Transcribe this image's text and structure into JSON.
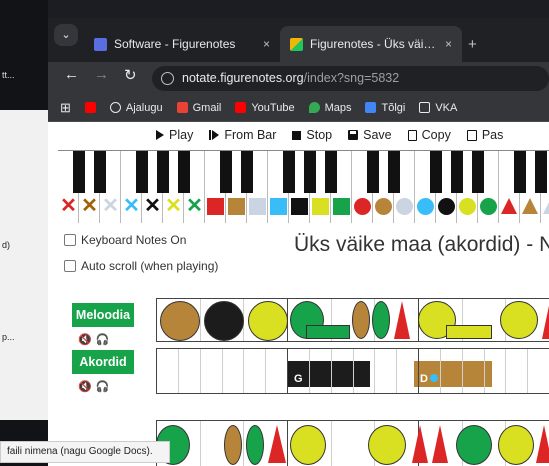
{
  "browser": {
    "tabs": [
      {
        "title": "Software - Figurenotes",
        "active": false,
        "favicon_color": "#5b6ee1"
      },
      {
        "title": "Figurenotes - Üks väike maa (akordid)",
        "active": true,
        "favicon_color": "#f2b705"
      }
    ],
    "close_glyph": "×",
    "new_tab_glyph": "+",
    "url_host": "notate.figurenotes.org",
    "url_path": "/index?sng=5832",
    "bookmarks": [
      {
        "label": "Ajalugu",
        "icon": "history-icon",
        "color": "#e8eaed"
      },
      {
        "label": "Gmail",
        "icon": "gmail-icon",
        "color": "#ea4335"
      },
      {
        "label": "YouTube",
        "icon": "youtube-icon",
        "color": "#ff0000"
      },
      {
        "label": "Maps",
        "icon": "maps-icon",
        "color": "#34a853"
      },
      {
        "label": "Tõlgi",
        "icon": "translate-icon",
        "color": "#4285f4"
      },
      {
        "label": "VKA",
        "icon": "folder-icon",
        "color": "#e8eaed"
      }
    ]
  },
  "left_window": {
    "text_top": "tt...",
    "text_mid": "d)",
    "text_bottom": "p..."
  },
  "controls": {
    "play": "Play",
    "from_bar": "From Bar",
    "stop": "Stop",
    "save": "Save",
    "copy": "Copy",
    "paste": "Pas"
  },
  "options": {
    "keyboard_notes": "Keyboard Notes On",
    "auto_scroll": "Auto scroll (when playing)"
  },
  "song_title": "Üks väike maa (akordid) - Ne",
  "tracks": {
    "melody": "Meloodia",
    "chords": "Akordid",
    "mute_icon": "🔇",
    "headphone_icon": "🎧"
  },
  "keyboard_marks": [
    {
      "shape": "x",
      "color": "#dc2626"
    },
    {
      "shape": "x",
      "color": "#a16207"
    },
    {
      "shape": "x",
      "color": "#cbd5e1"
    },
    {
      "shape": "x",
      "color": "#38bdf8"
    },
    {
      "shape": "x",
      "color": "#111111"
    },
    {
      "shape": "x",
      "color": "#d9e021"
    },
    {
      "shape": "x",
      "color": "#16a34a"
    },
    {
      "shape": "square",
      "color": "#dc2626"
    },
    {
      "shape": "square",
      "color": "#b7853a"
    },
    {
      "shape": "square",
      "color": "#cbd5e1"
    },
    {
      "shape": "square",
      "color": "#38bdf8"
    },
    {
      "shape": "square",
      "color": "#111111"
    },
    {
      "shape": "square",
      "color": "#d9e021"
    },
    {
      "shape": "square",
      "color": "#16a34a"
    },
    {
      "shape": "circle",
      "color": "#dc2626"
    },
    {
      "shape": "circle",
      "color": "#b7853a"
    },
    {
      "shape": "circle",
      "color": "#cbd5e1"
    },
    {
      "shape": "circle",
      "color": "#38bdf8"
    },
    {
      "shape": "circle",
      "color": "#111111"
    },
    {
      "shape": "circle",
      "color": "#d9e021"
    },
    {
      "shape": "circle",
      "color": "#16a34a"
    },
    {
      "shape": "triangle",
      "color": "#dc2626"
    },
    {
      "shape": "triangle",
      "color": "#b7853a"
    },
    {
      "shape": "triangle",
      "color": "#cbd5e1"
    }
  ],
  "chord_labels": {
    "first": "G",
    "second": "D"
  },
  "status_tooltip": "faili nimena (nagu Google Docs)."
}
